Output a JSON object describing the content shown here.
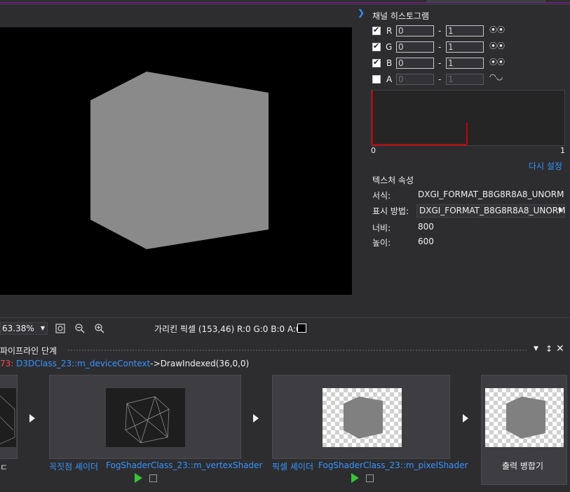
{
  "channels_panel": {
    "title": "채널 히스토그램",
    "channels": [
      {
        "name": "R",
        "checked": true,
        "min": "0",
        "max": "1",
        "linked": true
      },
      {
        "name": "G",
        "checked": true,
        "min": "0",
        "max": "1",
        "linked": true
      },
      {
        "name": "B",
        "checked": true,
        "min": "0",
        "max": "1",
        "linked": true
      },
      {
        "name": "A",
        "checked": false,
        "min": "0",
        "max": "1",
        "linked": false
      }
    ],
    "dash": "-",
    "axis_min": "0",
    "axis_max": "1",
    "reset_link": "다시 설정"
  },
  "texture_props": {
    "title": "텍스처 속성",
    "format_label": "서식:",
    "format_value": "DXGI_FORMAT_B8G8R8A8_UNORM",
    "display_label": "표시 방법:",
    "display_value": "DXGI_FORMAT_B8G8R8A8_UNORM",
    "width_label": "너비:",
    "width_value": "800",
    "height_label": "높이:",
    "height_value": "600"
  },
  "toolbar": {
    "zoom": "63.38%",
    "picked_pixel": "가리킨 픽셀 (153,46) R:0 G:0 B:0 A:0"
  },
  "pipeline": {
    "title": "파이프라인 단계",
    "call_index": "73:",
    "call_object": "D3DClass_23::m_deviceContext",
    "call_arrow": "->",
    "call_method": "DrawIndexed(36,0,0)",
    "stages": [
      {
        "label": "꼭짓점 셰이더",
        "link": "FogShaderClass_23::m_vertexShader"
      },
      {
        "label": "픽셀 셰이더",
        "link": "FogShaderClass_23::m_pixelShader"
      },
      {
        "label": "출력 병합기"
      }
    ],
    "header_icons": [
      "dropdown-icon",
      "pin-icon",
      "close-icon"
    ]
  },
  "colors": {
    "accent": "#68217a",
    "link": "#3794ff",
    "call_index": "#f14c4c",
    "histogram": "#c80000",
    "cube": "#8a8a8a",
    "play": "#39c339"
  }
}
